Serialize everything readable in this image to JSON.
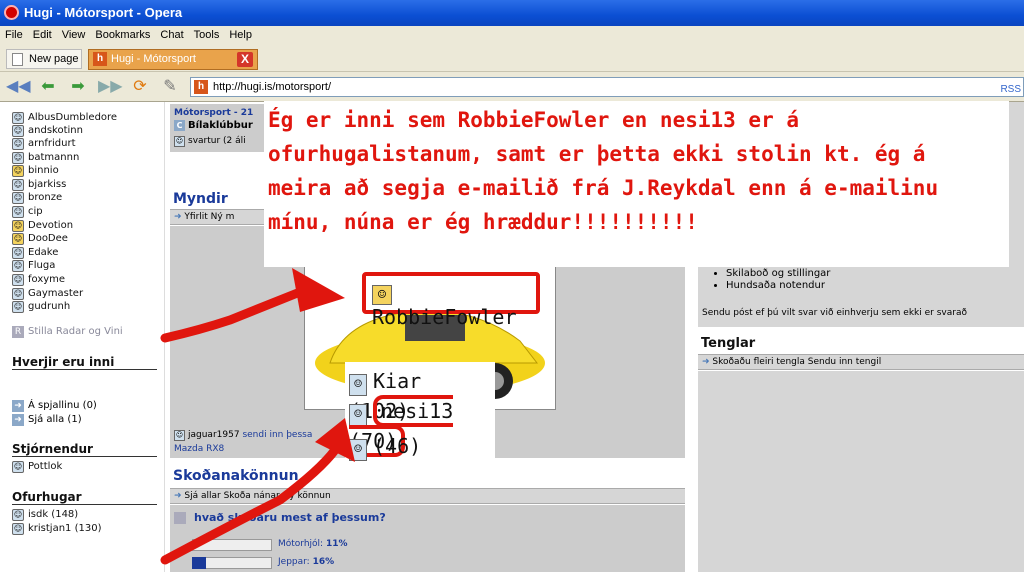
{
  "window": {
    "title": "Hugi - Mótorsport - Opera"
  },
  "menu": [
    "File",
    "Edit",
    "View",
    "Bookmarks",
    "Chat",
    "Tools",
    "Help"
  ],
  "tabs": {
    "new_page": "New page",
    "active": "Hugi - Mótorsport",
    "close": "X"
  },
  "address": {
    "url": "http://hugi.is/motorsport/",
    "rss": "RSS"
  },
  "left": {
    "users": [
      "AlbusDumbledore",
      "andskotinn",
      "arnfridurt",
      "batmannn",
      "binnio",
      "bjarkiss",
      "bronze",
      "cip",
      "Devotion",
      "DooDee",
      "Edake",
      "Fluga",
      "foxyme",
      "Gaymaster",
      "gudrunh"
    ],
    "radar": "Stilla Radar og Vini",
    "who_heading": "Hverjir eru inni",
    "chat_link": "Á spjallinu (0)",
    "see_all": "Sjá alla (1)",
    "mods_heading": "Stjórnendur",
    "mod": "Pottlok",
    "ofurhugar_heading": "Ofurhugar",
    "ofurhugar": [
      "isdk (148)",
      "kristjan1 (130)"
    ]
  },
  "middle": {
    "section_title": "Mótorsport - 21",
    "club": "Bílaklúbbur",
    "club_sub": "svartur (2 áli",
    "myndir": "Myndir",
    "myndir_links": "Yfirlit  Ný m",
    "poster": "jaguar1957",
    "poster_action": "sendi inn þessa",
    "car": "Mazda RX8",
    "poll_title": "Skoðanakönnun",
    "poll_links": "Sjá allar  Skoða nánar  Ný könnun",
    "question": "hvað skoðaru mest af þessum?",
    "poll": [
      {
        "label": "Mótorhjól:",
        "pct": "11%",
        "value": 11
      },
      {
        "label": "Jeppar:",
        "pct": "16%",
        "value": 16
      }
    ],
    "zoom_robbie": "RobbieFowler",
    "zoom_kiar": "Kiar (102)",
    "zoom_nesi": "nesi13 (70)",
    "zoom_46": "(46)"
  },
  "right": {
    "bullets": [
      "Skilaboð og stillingar",
      "Hundsaða notendur"
    ],
    "mail_note": "Sendu póst ef þú vilt svar við einhverju sem ekki er svarað",
    "tenglar": "Tenglar",
    "tenglar_links": "Skoðaðu fleiri tengla  Sendu inn tengil"
  },
  "callout_lines": [
    "Ég er inni sem RobbieFowler en nesi13 er á",
    "ofurhugalistanum, samt er þetta ekki stolin kt. ég á",
    "meira að segja e-mailið frá J.Reykdal enn á e-mailinu",
    "mínu, núna er ég hræddur!!!!!!!!!!"
  ],
  "colors": {
    "annotation": "#e0160e",
    "title_bar": "#0b4fd3",
    "link_blue": "#1a3a9a"
  }
}
